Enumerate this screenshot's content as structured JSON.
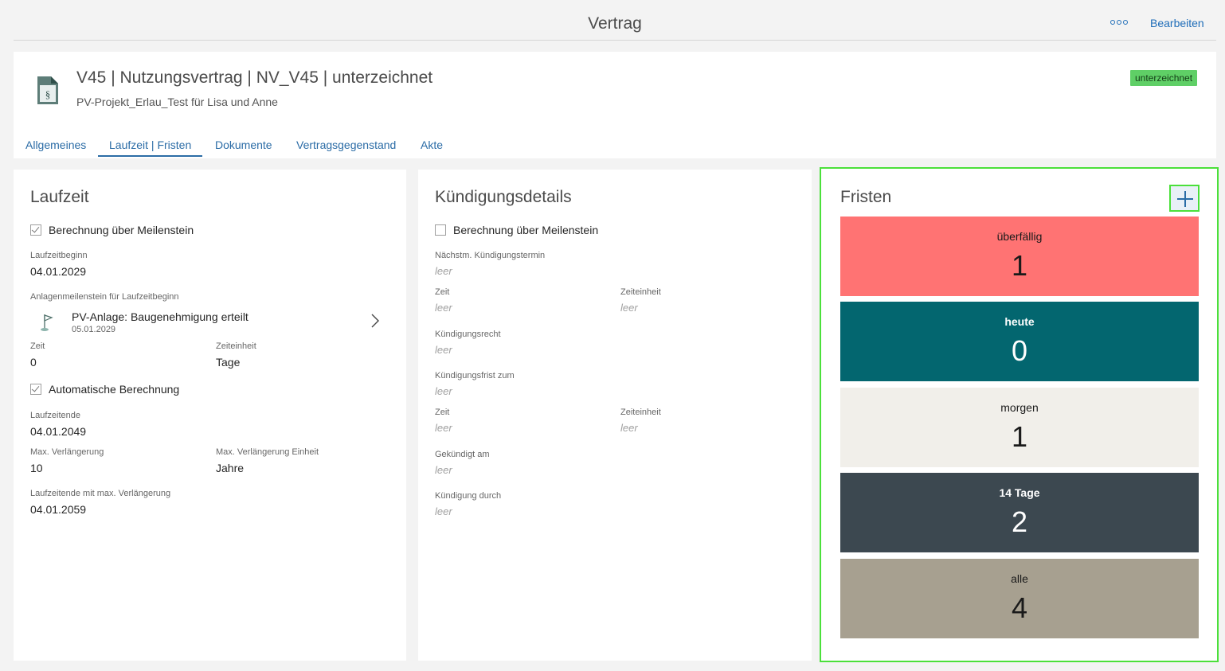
{
  "topbar": {
    "title": "Vertrag",
    "more_label": "ooo",
    "edit_label": "Bearbeiten"
  },
  "header": {
    "title": "V45 | Nutzungsvertrag | NV_V45 | unterzeichnet",
    "subtitle": "PV-Projekt_Erlau_Test für Lisa und Anne",
    "status": "unterzeichnet",
    "icon": "contract-document-icon",
    "icon_glyph": "§",
    "tabs": [
      {
        "label": "Allgemeines",
        "active": false
      },
      {
        "label": "Laufzeit | Fristen",
        "active": true
      },
      {
        "label": "Dokumente",
        "active": false
      },
      {
        "label": "Vertragsgegenstand",
        "active": false
      },
      {
        "label": "Akte",
        "active": false
      }
    ]
  },
  "laufzeit": {
    "title": "Laufzeit",
    "calc_milestone": {
      "label": "Berechnung über Meilenstein",
      "checked": true
    },
    "begin_label": "Laufzeitbeginn",
    "begin_value": "04.01.2029",
    "milestone_label": "Anlagenmeilenstein für Laufzeitbeginn",
    "milestone": {
      "title": "PV-Anlage: Baugenehmigung erteilt",
      "date": "05.01.2029",
      "icon": "flag-icon"
    },
    "zeit_label": "Zeit",
    "zeit_value": "0",
    "zeiteinheit_label": "Zeiteinheit",
    "zeiteinheit_value": "Tage",
    "auto_calc": {
      "label": "Automatische Berechnung",
      "checked": true
    },
    "end_label": "Laufzeitende",
    "end_value": "04.01.2049",
    "max_ext_label": "Max. Verlängerung",
    "max_ext_value": "10",
    "max_ext_unit_label": "Max. Verlängerung Einheit",
    "max_ext_unit_value": "Jahre",
    "end_max_label": "Laufzeitende mit max. Verlängerung",
    "end_max_value": "04.01.2059"
  },
  "kuendigung": {
    "title": "Kündigungsdetails",
    "calc_milestone": {
      "label": "Berechnung über Meilenstein",
      "checked": false
    },
    "empty_text": "leer",
    "next_date_label": "Nächstm. Kündigungstermin",
    "zeit1_label": "Zeit",
    "zeiteinheit1_label": "Zeiteinheit",
    "recht_label": "Kündigungsrecht",
    "frist_label": "Kündigungsfrist zum",
    "zeit2_label": "Zeit",
    "zeiteinheit2_label": "Zeiteinheit",
    "gekuendigt_label": "Gekündigt am",
    "durch_label": "Kündigung durch"
  },
  "fristen": {
    "title": "Fristen",
    "add_icon": "plus-icon",
    "tiles": [
      {
        "label": "überfällig",
        "count": "1",
        "bg": "#ff7373",
        "fg": "#1a1a1a"
      },
      {
        "label": "heute",
        "count": "0",
        "bg": "#03666f",
        "fg": "#ffffff"
      },
      {
        "label": "morgen",
        "count": "1",
        "bg": "#f1efea",
        "fg": "#1a1a1a"
      },
      {
        "label": "14 Tage",
        "count": "2",
        "bg": "#3c4850",
        "fg": "#ffffff"
      },
      {
        "label": "alle",
        "count": "4",
        "bg": "#a7a090",
        "fg": "#1a1a1a"
      }
    ]
  }
}
